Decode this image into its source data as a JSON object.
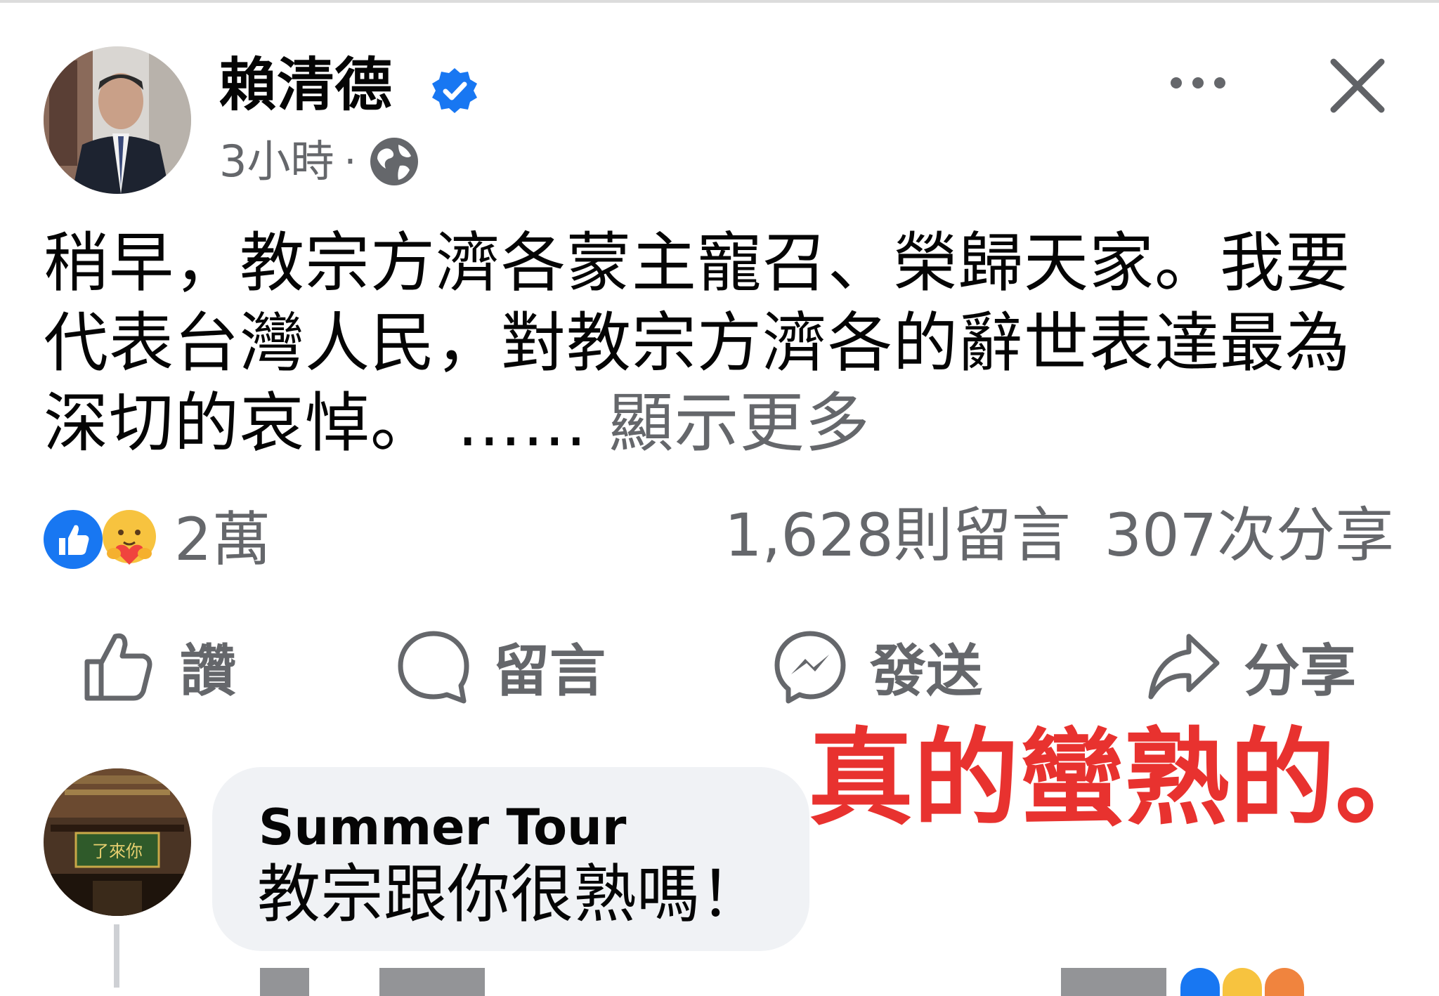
{
  "post": {
    "author": "賴清德",
    "time": "3小時",
    "separator": "·",
    "text_lines": [
      "稍早，教宗方濟各蒙主寵召、榮歸天家。我要",
      "代表台灣人民，對教宗方濟各的辭世表達最為",
      "深切的哀悼。 ……"
    ],
    "see_more": "顯示更多"
  },
  "stats": {
    "reactions_count": "2萬",
    "comments": "1,628則留言",
    "shares": "307次分享"
  },
  "actions": {
    "like": "讚",
    "comment": "留言",
    "send": "發送",
    "share": "分享"
  },
  "annotation": "真的蠻熟的。",
  "comment": {
    "author": "Summer Tour",
    "text": "教宗跟你很熟嗎！",
    "avatar_sign": "了來你"
  },
  "colors": {
    "accent_blue": "#1877f2",
    "secondary_text": "#65676b",
    "annotation_red": "#e8322f",
    "bubble_bg": "#f0f2f5"
  },
  "icons": [
    "verified-badge-icon",
    "globe-icon",
    "more-options-icon",
    "close-icon",
    "like-reaction-icon",
    "care-reaction-icon",
    "thumbs-up-icon",
    "comment-icon",
    "messenger-icon",
    "share-arrow-icon"
  ]
}
